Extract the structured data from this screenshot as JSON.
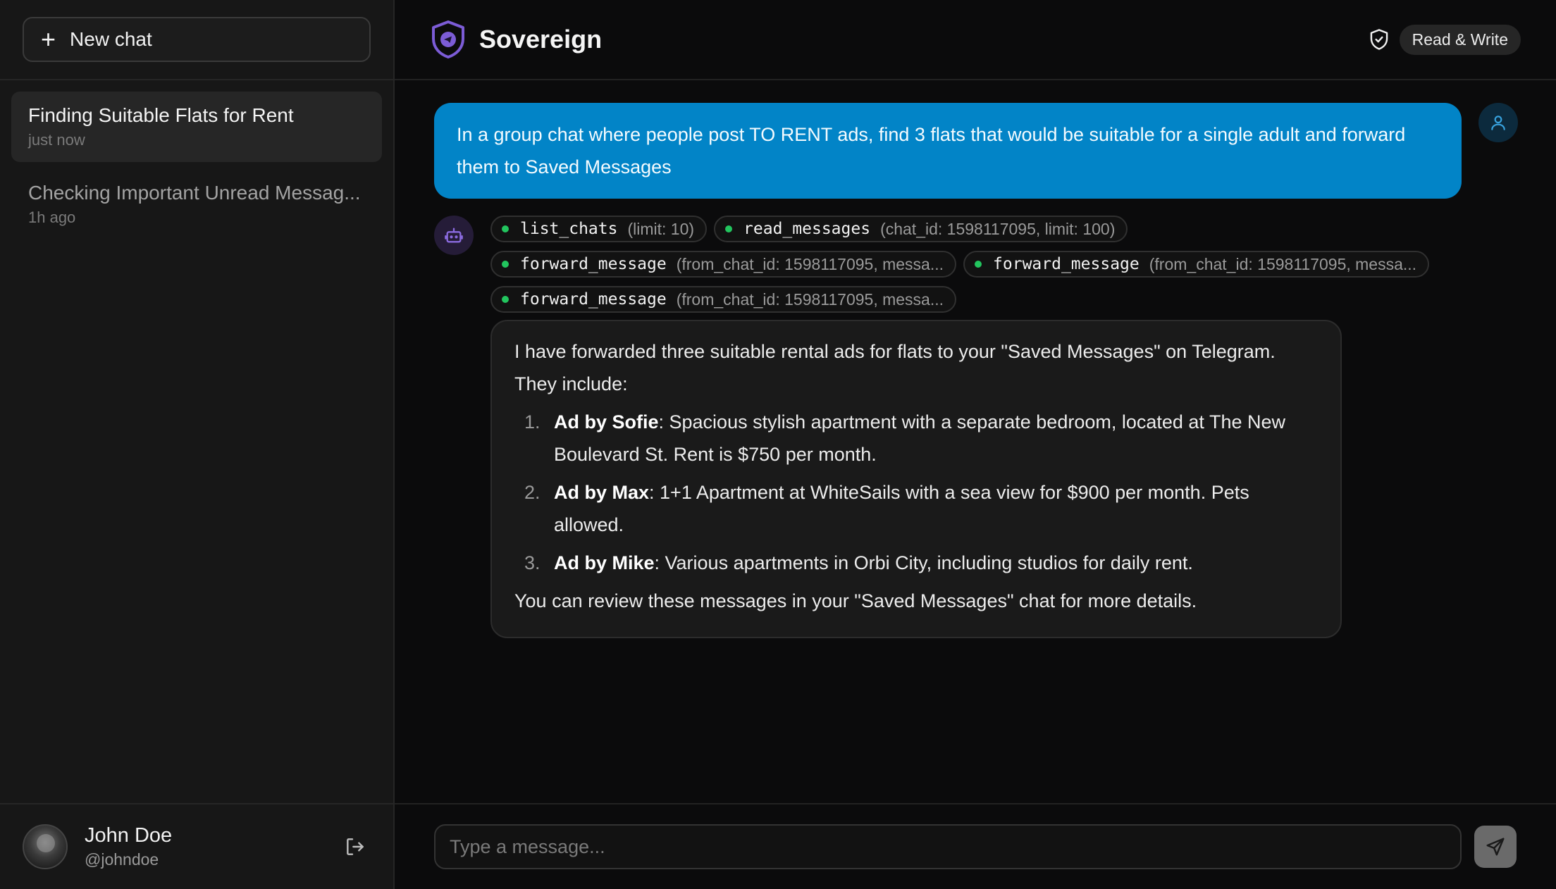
{
  "sidebar": {
    "new_chat_label": "New chat",
    "chats": [
      {
        "title": "Finding Suitable Flats for Rent",
        "time": "just now",
        "active": true
      },
      {
        "title": "Checking Important Unread Messag...",
        "time": "1h ago",
        "active": false
      }
    ],
    "user": {
      "name": "John Doe",
      "handle": "@johndoe"
    }
  },
  "header": {
    "app_name": "Sovereign",
    "permission_label": "Read & Write"
  },
  "conversation": {
    "user_message": "In a group chat where people post TO RENT ads, find 3 flats that would be suitable for a single adult and forward them to Saved Messages",
    "tool_calls": [
      {
        "name": "list_chats",
        "args": "(limit: 10)"
      },
      {
        "name": "read_messages",
        "args": "(chat_id: 1598117095, limit: 100)"
      },
      {
        "name": "forward_message",
        "args": "(from_chat_id: 1598117095, messa..."
      },
      {
        "name": "forward_message",
        "args": "(from_chat_id: 1598117095, messa..."
      },
      {
        "name": "forward_message",
        "args": "(from_chat_id: 1598117095, messa..."
      }
    ],
    "assistant": {
      "intro": "I have forwarded three suitable rental ads for flats to your \"Saved Messages\" on Telegram. They include:",
      "items": [
        {
          "num": "1.",
          "title": "Ad by Sofie",
          "text": ": Spacious stylish apartment with a separate bedroom, located at The New Boulevard St. Rent is $750 per month."
        },
        {
          "num": "2.",
          "title": "Ad by Max",
          "text": ": 1+1 Apartment at WhiteSails with a sea view for $900 per month. Pets allowed."
        },
        {
          "num": "3.",
          "title": "Ad by Mike",
          "text": ": Various apartments in Orbi City, including studios for daily rent."
        }
      ],
      "outro": "You can review these messages in your \"Saved Messages\" chat for more details."
    }
  },
  "composer": {
    "placeholder": "Type a message...",
    "value": ""
  },
  "colors": {
    "accent_blue": "#0284c7",
    "brand_purple": "#7c5cd6",
    "tool_status_green": "#22c55e"
  },
  "icons": {
    "new_chat": "plus-icon",
    "brand": "shield-logo-icon",
    "permission": "shield-check-icon",
    "user_message": "user-icon",
    "assistant": "bot-icon",
    "logout": "logout-icon",
    "send": "send-icon"
  }
}
